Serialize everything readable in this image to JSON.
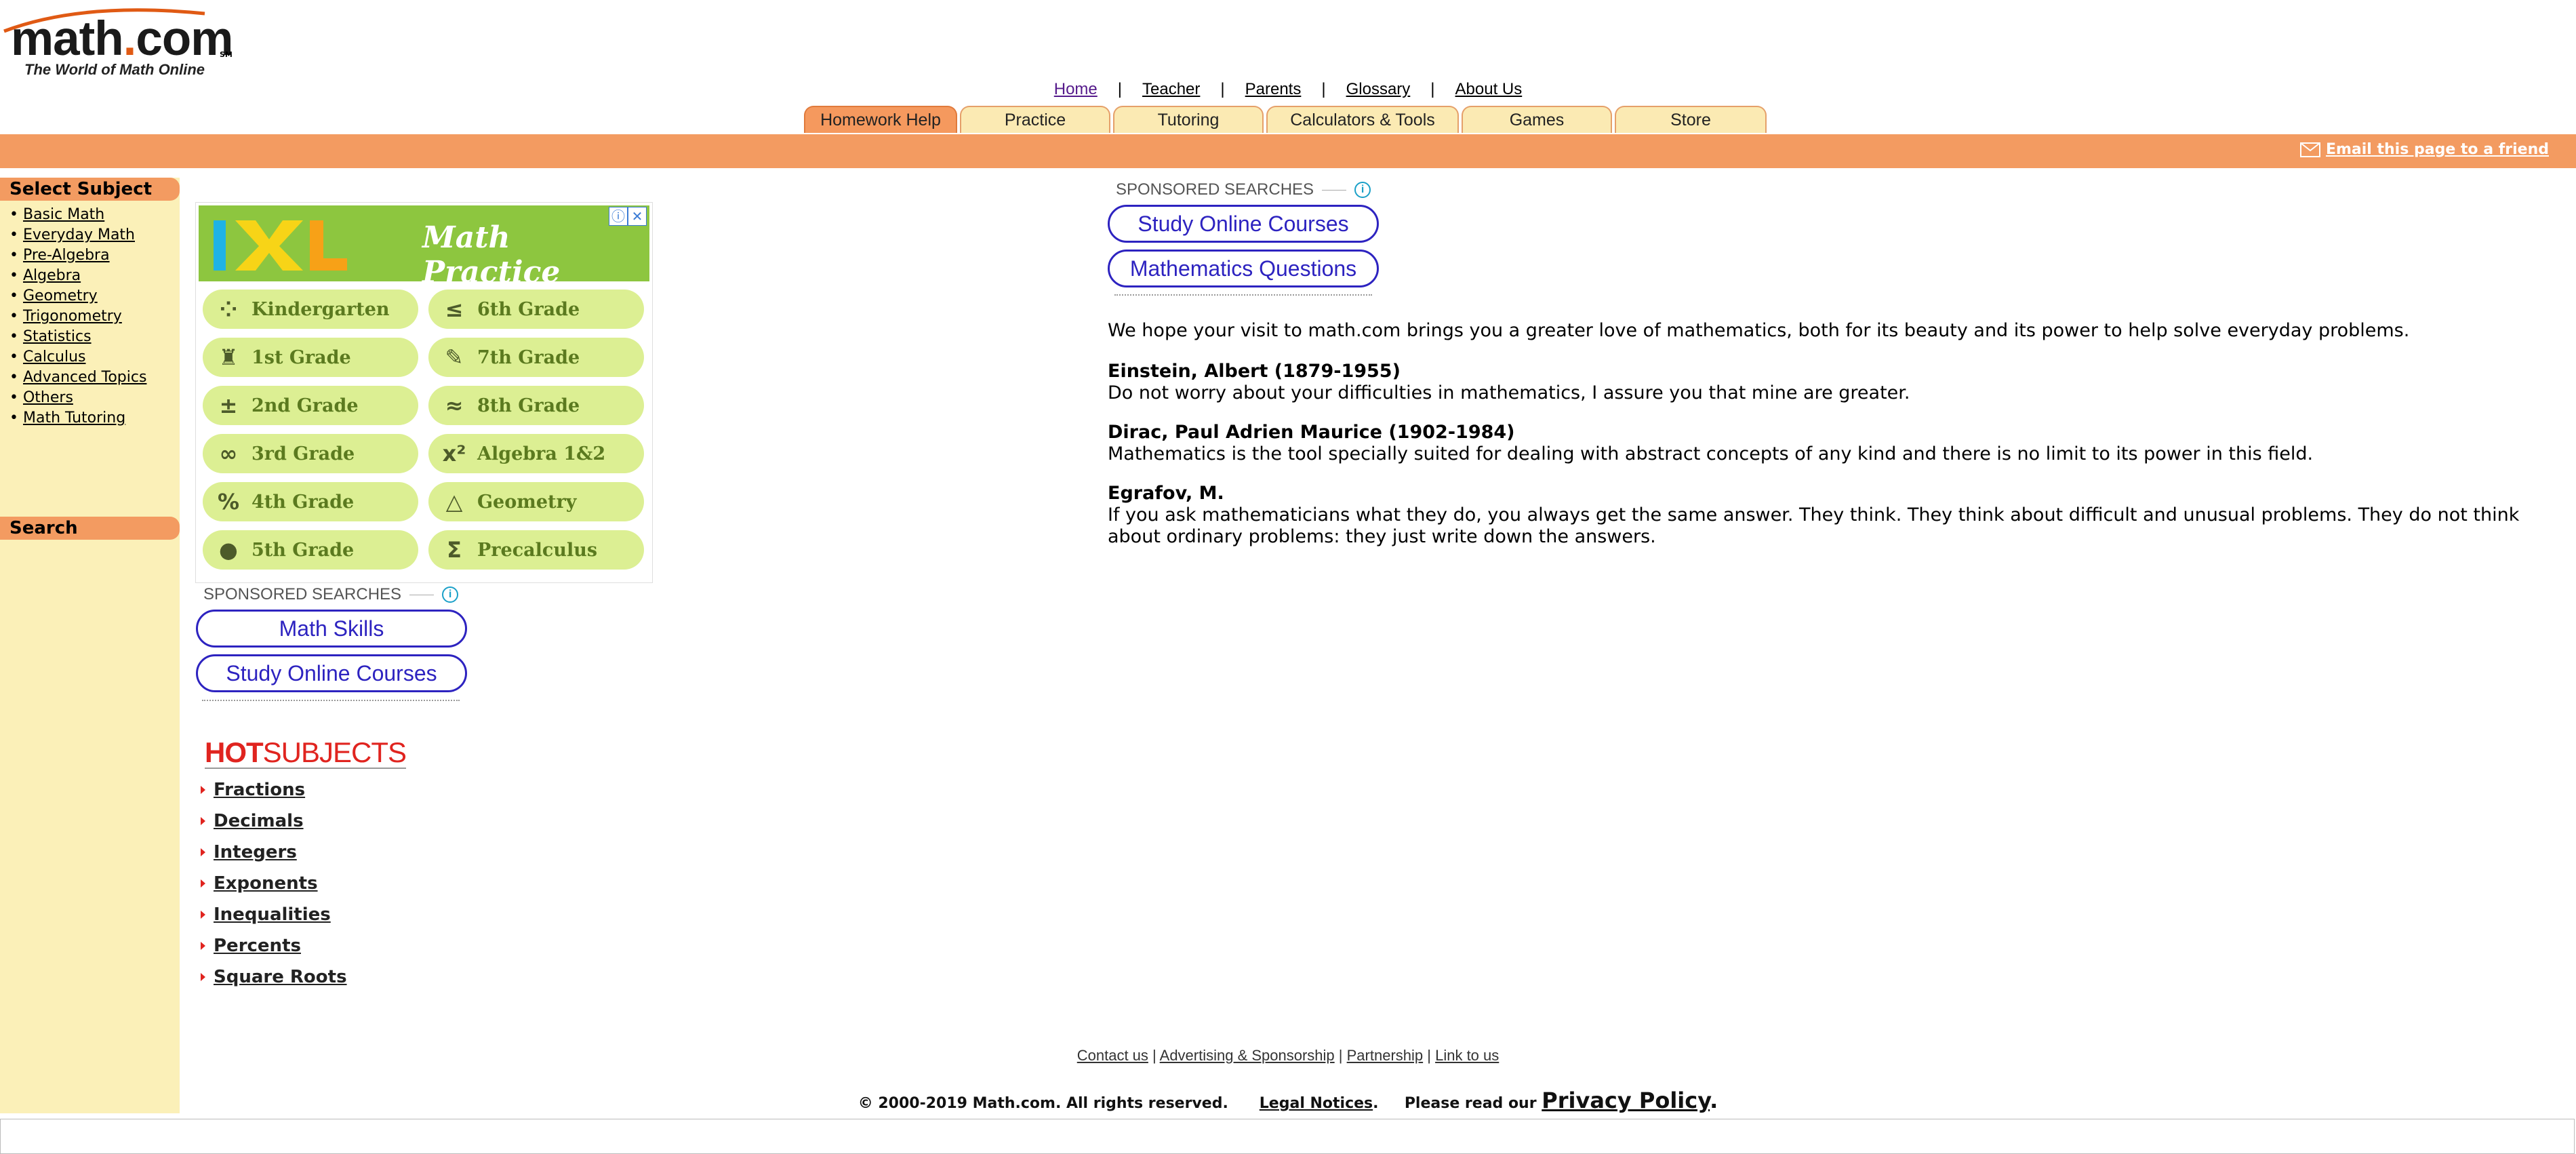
{
  "logo": {
    "name_prefix": "math",
    "name_dot": ".",
    "name_suffix": "com",
    "sm": "SM",
    "tagline": "The World of Math Online"
  },
  "top_nav": [
    "Home",
    "Teacher",
    "Parents",
    "Glossary",
    "About Us"
  ],
  "tabs": [
    "Homework Help",
    "Practice",
    "Tutoring",
    "Calculators & Tools",
    "Games",
    "Store"
  ],
  "email_link": "Email this page to a friend",
  "sidebar": {
    "select_subject": "Select Subject",
    "subjects": [
      "Basic Math",
      "Everyday Math",
      "Pre-Algebra",
      "Algebra",
      "Geometry",
      "Trigonometry",
      "Statistics",
      "Calculus",
      "Advanced Topics",
      "Others",
      "Math Tutoring"
    ],
    "search": "Search"
  },
  "ixl_ad": {
    "logo": "IXL",
    "title": "Math Practice",
    "grades": [
      {
        "label": "Kindergarten",
        "icon": "dots-icon",
        "glyph": "⁘"
      },
      {
        "label": "6th Grade",
        "icon": "less-equal-icon",
        "glyph": "≤"
      },
      {
        "label": "1st Grade",
        "icon": "pencil-cup-icon",
        "glyph": "♜"
      },
      {
        "label": "7th Grade",
        "icon": "pencil-icon",
        "glyph": "✎"
      },
      {
        "label": "2nd Grade",
        "icon": "plus-minus-icon",
        "glyph": "±"
      },
      {
        "label": "8th Grade",
        "icon": "approx-icon",
        "glyph": "≈"
      },
      {
        "label": "3rd Grade",
        "icon": "infinity-icon",
        "glyph": "∞"
      },
      {
        "label": "Algebra 1&2",
        "icon": "x-squared-icon",
        "glyph": "x²"
      },
      {
        "label": "4th Grade",
        "icon": "percent-icon",
        "glyph": "%"
      },
      {
        "label": "Geometry",
        "icon": "triangle-icon",
        "glyph": "△"
      },
      {
        "label": "5th Grade",
        "icon": "apple-icon",
        "glyph": "●"
      },
      {
        "label": "Precalculus",
        "icon": "sigma-icon",
        "glyph": "Σ"
      }
    ]
  },
  "sponsored_left": {
    "label": "SPONSORED SEARCHES",
    "links": [
      "Math Skills",
      "Study Online Courses"
    ]
  },
  "sponsored_right": {
    "label": "SPONSORED SEARCHES",
    "links": [
      "Study Online Courses",
      "Mathematics Questions"
    ]
  },
  "hot_subjects": {
    "hot": "HOT",
    "subjects_word": "SUBJECTS",
    "items": [
      "Fractions",
      "Decimals",
      "Integers",
      "Exponents",
      "Inequalities",
      "Percents",
      "Square Roots"
    ]
  },
  "main": {
    "intro": "We hope your visit to math.com brings you a greater love of mathematics, both for its beauty and its power to help solve everyday problems.",
    "quotes": [
      {
        "author": "Einstein, Albert (1879-1955)",
        "text": "Do not worry about your difficulties in mathematics, I assure you that mine are greater."
      },
      {
        "author": "Dirac, Paul Adrien Maurice (1902-1984)",
        "text": "Mathematics is the tool specially suited for dealing with abstract concepts of any kind and there is no limit to its power in this field."
      },
      {
        "author": "Egrafov, M.",
        "text": "If you ask mathematicians what they do, you always get the same answer. They think. They think about difficult and unusual problems. They do not think about ordinary problems: they just write down the answers."
      }
    ]
  },
  "footer": {
    "links": [
      "Contact us",
      "Advertising & Sponsorship",
      "Partnership",
      "Link to us"
    ],
    "copyright": "© 2000-2019 Math.com. All rights reserved.",
    "legal": "Legal Notices",
    "please_read": "Please read our",
    "privacy": "Privacy Policy"
  },
  "colors": {
    "orange": "#f39b61",
    "sidebar_bg": "#fbf0b8",
    "tab_bg": "#fbeab3",
    "ixl_green": "#8dc63f",
    "link_blue": "#2d23c0",
    "hot_red": "#e0241f"
  }
}
